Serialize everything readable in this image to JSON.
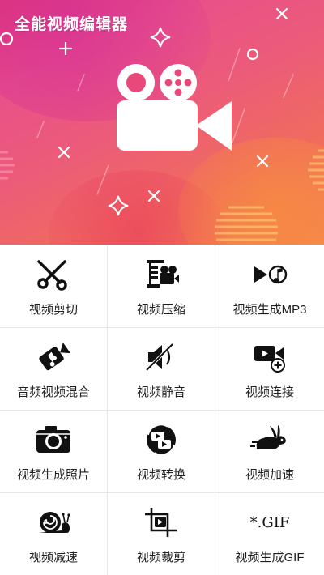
{
  "banner": {
    "title": "全能视频编辑器",
    "colors": {
      "gradient_start": "#e0356f",
      "gradient_mid": "#ec5c78",
      "gradient_end": "#f5894e"
    }
  },
  "tools": [
    {
      "label": "视频剪切",
      "icon": "scissors-icon"
    },
    {
      "label": "视频压缩",
      "icon": "clamp-camera-icon"
    },
    {
      "label": "视频生成MP3",
      "icon": "play-music-icon"
    },
    {
      "label": "音频视频混合",
      "icon": "camera-music-icon"
    },
    {
      "label": "视频静音",
      "icon": "mute-speaker-icon"
    },
    {
      "label": "视频连接",
      "icon": "camera-add-icon"
    },
    {
      "label": "视频生成照片",
      "icon": "photo-camera-icon"
    },
    {
      "label": "视频转换",
      "icon": "convert-icon"
    },
    {
      "label": "视频加速",
      "icon": "rabbit-icon"
    },
    {
      "label": "视频减速",
      "icon": "snail-icon"
    },
    {
      "label": "视频裁剪",
      "icon": "crop-video-icon"
    },
    {
      "label": "视频生成GIF",
      "icon": "gif-icon",
      "icon_text": "*.GIF"
    }
  ]
}
